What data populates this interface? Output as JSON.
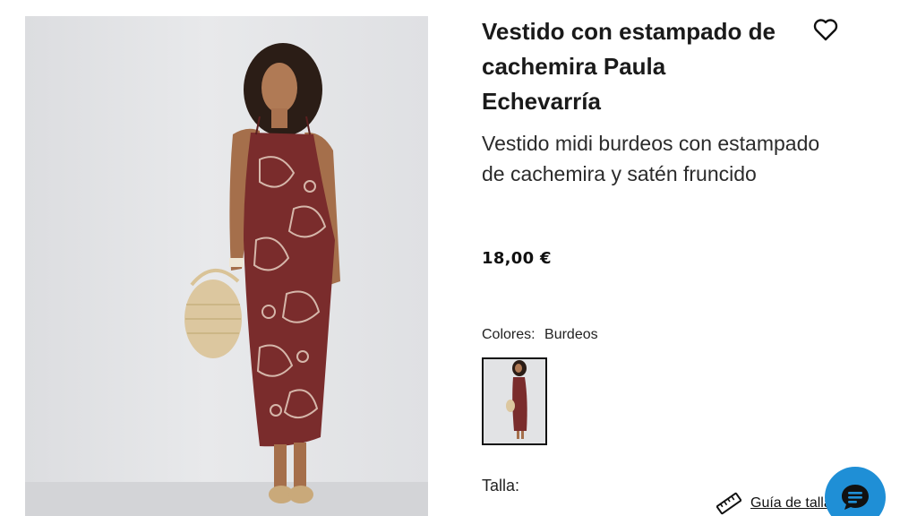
{
  "product": {
    "title": "Vestido con estampado de cachemira Paula Echevarría",
    "subtitle": "Vestido midi burdeos con estampado de cachemira y satén fruncido",
    "price": "18,00 €"
  },
  "colors": {
    "label": "Colores:",
    "selected": "Burdeos",
    "swatches": [
      {
        "name": "Burdeos",
        "color": "#7a2c2c"
      }
    ]
  },
  "size": {
    "label": "Talla:",
    "guide_label": "Guía de tallas"
  },
  "icons": {
    "wishlist": "heart-outline-icon",
    "size_guide": "ruler-icon",
    "chat": "chat-bubble-icon"
  },
  "theme": {
    "accent": "#1f8fd6",
    "dress": "#7a2c2c",
    "text": "#1a1a1a"
  }
}
